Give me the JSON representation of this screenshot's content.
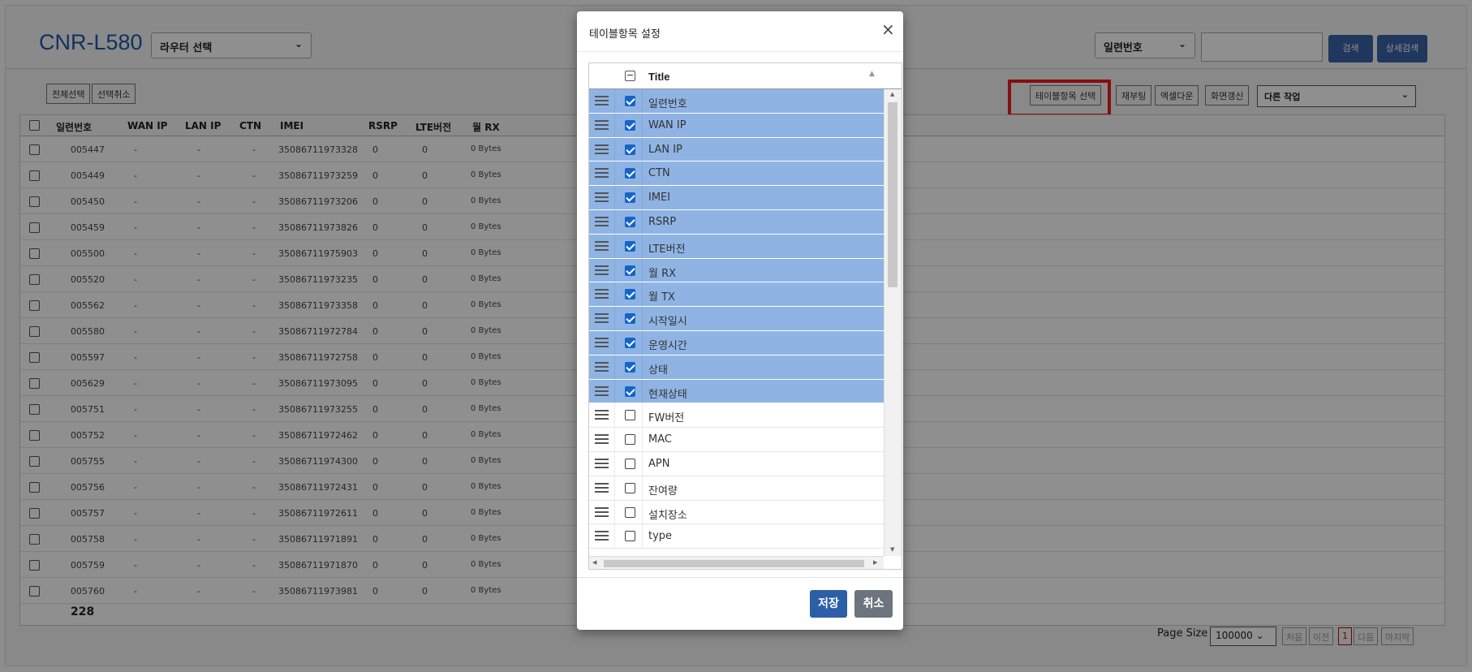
{
  "header": {
    "brand": "CNR-L580",
    "router_select": "라우터 선택",
    "search_field_select": "일련번호",
    "search_input_value": "",
    "search_button": "검색",
    "advanced_search_button": "상세검색"
  },
  "toolbar": {
    "select_all": "전체선택",
    "deselect": "선택취소",
    "table_items_select": "테이블항목 선택",
    "reboot": "재부팅",
    "excel_download": "엑셀다운",
    "refresh": "화면갱신",
    "other_actions": "다른 작업"
  },
  "grid": {
    "columns": [
      "일련번호",
      "WAN IP",
      "LAN IP",
      "CTN",
      "IMEI",
      "RSRP",
      "LTE버전",
      "월 RX"
    ],
    "rows": [
      [
        "005447",
        "-",
        "-",
        "-",
        "35086711973328",
        "0",
        "0",
        "0 Bytes"
      ],
      [
        "005449",
        "-",
        "-",
        "-",
        "35086711973259",
        "0",
        "0",
        "0 Bytes"
      ],
      [
        "005450",
        "-",
        "-",
        "-",
        "35086711973206",
        "0",
        "0",
        "0 Bytes"
      ],
      [
        "005459",
        "-",
        "-",
        "-",
        "35086711973826",
        "0",
        "0",
        "0 Bytes"
      ],
      [
        "005500",
        "-",
        "-",
        "-",
        "35086711975903",
        "0",
        "0",
        "0 Bytes"
      ],
      [
        "005520",
        "-",
        "-",
        "-",
        "35086711973235",
        "0",
        "0",
        "0 Bytes"
      ],
      [
        "005562",
        "-",
        "-",
        "-",
        "35086711973358",
        "0",
        "0",
        "0 Bytes"
      ],
      [
        "005580",
        "-",
        "-",
        "-",
        "35086711972784",
        "0",
        "0",
        "0 Bytes"
      ],
      [
        "005597",
        "-",
        "-",
        "-",
        "35086711972758",
        "0",
        "0",
        "0 Bytes"
      ],
      [
        "005629",
        "-",
        "-",
        "-",
        "35086711973095",
        "0",
        "0",
        "0 Bytes"
      ],
      [
        "005751",
        "-",
        "-",
        "-",
        "35086711973255",
        "0",
        "0",
        "0 Bytes"
      ],
      [
        "005752",
        "-",
        "-",
        "-",
        "35086711972462",
        "0",
        "0",
        "0 Bytes"
      ],
      [
        "005755",
        "-",
        "-",
        "-",
        "35086711974300",
        "0",
        "0",
        "0 Bytes"
      ],
      [
        "005756",
        "-",
        "-",
        "-",
        "35086711972431",
        "0",
        "0",
        "0 Bytes"
      ],
      [
        "005757",
        "-",
        "-",
        "-",
        "35086711972611",
        "0",
        "0",
        "0 Bytes"
      ],
      [
        "005758",
        "-",
        "-",
        "-",
        "35086711971891",
        "0",
        "0",
        "0 Bytes"
      ],
      [
        "005759",
        "-",
        "-",
        "-",
        "35086711971870",
        "0",
        "0",
        "0 Bytes"
      ],
      [
        "005760",
        "-",
        "-",
        "-",
        "35086711973981",
        "0",
        "0",
        "0 Bytes"
      ]
    ],
    "total": "228"
  },
  "pager": {
    "page_size_label": "Page Size",
    "page_size": "100000",
    "first": "처음",
    "prev": "이전",
    "current": "1",
    "next": "다음",
    "last": "마지막"
  },
  "modal": {
    "title": "테이블항목 설정",
    "close": "×",
    "header_title": "Title",
    "items": [
      {
        "label": "일련번호",
        "checked": true
      },
      {
        "label": "WAN IP",
        "checked": true
      },
      {
        "label": "LAN IP",
        "checked": true
      },
      {
        "label": "CTN",
        "checked": true
      },
      {
        "label": "IMEI",
        "checked": true
      },
      {
        "label": "RSRP",
        "checked": true
      },
      {
        "label": "LTE버전",
        "checked": true
      },
      {
        "label": "월 RX",
        "checked": true
      },
      {
        "label": "월 TX",
        "checked": true
      },
      {
        "label": "시작일시",
        "checked": true
      },
      {
        "label": "운영시간",
        "checked": true
      },
      {
        "label": "상태",
        "checked": true
      },
      {
        "label": "현재상태",
        "checked": true
      },
      {
        "label": "FW버전",
        "checked": false
      },
      {
        "label": "MAC",
        "checked": false
      },
      {
        "label": "APN",
        "checked": false
      },
      {
        "label": "잔여량",
        "checked": false
      },
      {
        "label": "설치장소",
        "checked": false
      },
      {
        "label": "type",
        "checked": false
      }
    ],
    "save": "저장",
    "cancel": "취소"
  },
  "colors": {
    "brand": "#1e5aa8",
    "selected_row": "#8fb4e4",
    "save_button": "#2c5fa8",
    "cancel_button": "#6c757d",
    "highlight_box": "#ee1c1c"
  }
}
